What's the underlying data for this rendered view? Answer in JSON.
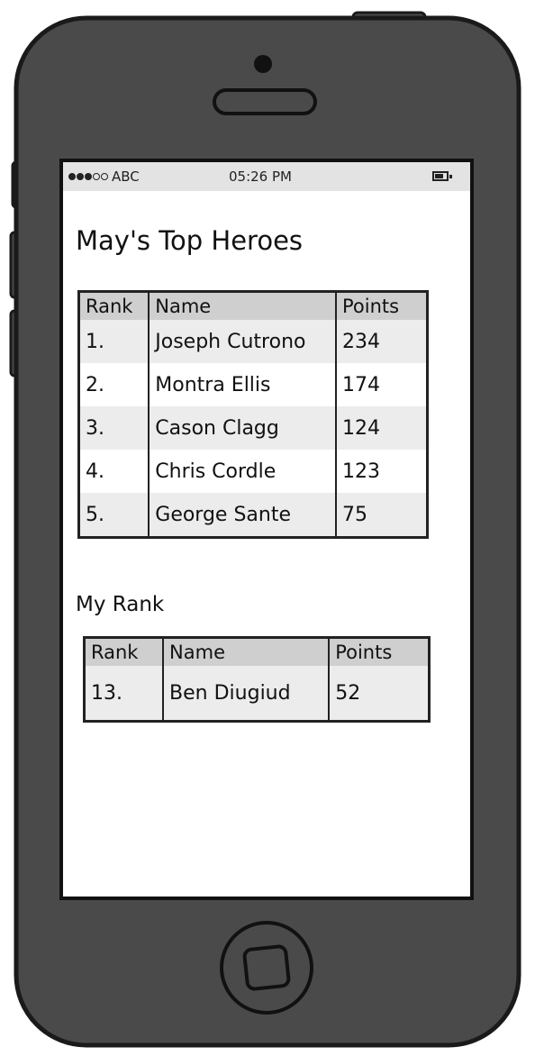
{
  "status_bar": {
    "carrier": "ABC",
    "time": "05:26 PM",
    "signal_icon": "signal-dots-icon",
    "battery_icon": "battery-icon"
  },
  "title": "May's Top Heroes",
  "top_table": {
    "headers": [
      "Rank",
      "Name",
      "Points"
    ],
    "rows": [
      [
        "1.",
        "Joseph Cutrono",
        "234"
      ],
      [
        "2.",
        "Montra Ellis",
        "174"
      ],
      [
        "3.",
        "Cason Clagg",
        "124"
      ],
      [
        "4.",
        "Chris Cordle",
        "123"
      ],
      [
        "5.",
        "George Sante",
        "75"
      ]
    ]
  },
  "my_rank": {
    "label": "My Rank",
    "headers": [
      "Rank",
      "Name",
      "Points"
    ],
    "rows": [
      [
        "13.",
        "Ben Diugiud",
        "52"
      ]
    ]
  },
  "colors": {
    "phone_body": "#4a4a4a",
    "outline": "#1a1a1a",
    "header_bg": "#cfcfcf",
    "stripe_bg": "#ececec",
    "status_bg": "#e3e3e3"
  }
}
